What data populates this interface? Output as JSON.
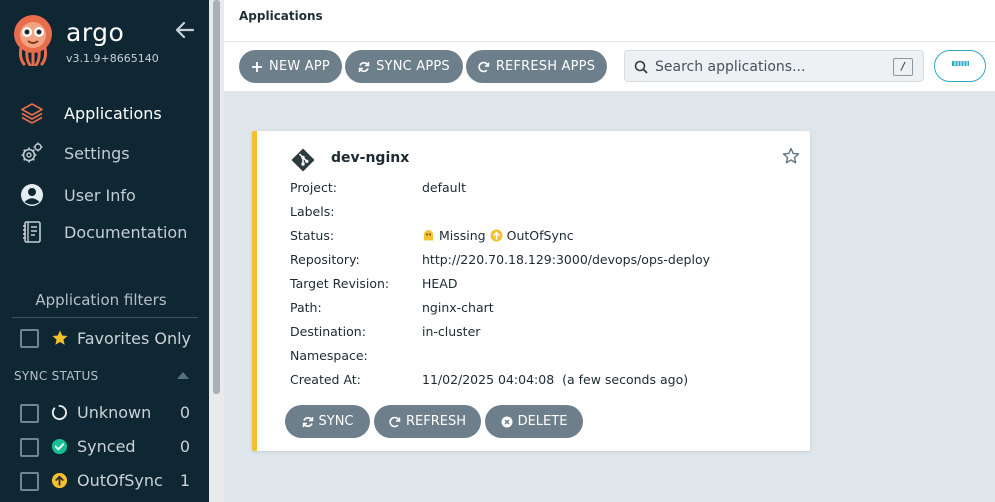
{
  "sidebar": {
    "brand": "argo",
    "version": "v3.1.9+8665140",
    "nav": [
      {
        "label": "Applications",
        "icon": "layers-icon",
        "active": true
      },
      {
        "label": "Settings",
        "icon": "gears-icon",
        "active": false
      },
      {
        "label": "User Info",
        "icon": "user-circle-icon",
        "active": false
      },
      {
        "label": "Documentation",
        "icon": "book-icon",
        "active": false
      }
    ],
    "filters_title": "Application filters",
    "favorites_label": "Favorites Only",
    "sync_status_header": "SYNC STATUS",
    "sync_filters": [
      {
        "label": "Unknown",
        "count": "0",
        "icon": "circle-notch-icon"
      },
      {
        "label": "Synced",
        "count": "0",
        "icon": "check-circle-icon"
      },
      {
        "label": "OutOfSync",
        "count": "1",
        "icon": "arrow-up-circle-icon"
      }
    ]
  },
  "header": {
    "breadcrumb": "Applications"
  },
  "toolbar": {
    "new_app": "NEW APP",
    "sync_apps": "SYNC APPS",
    "refresh_apps": "REFRESH APPS",
    "search_placeholder": "Search applications...",
    "search_shortcut": "/"
  },
  "app": {
    "name": "dev-nginx",
    "fields": [
      {
        "key": "Project:",
        "value": "default"
      },
      {
        "key": "Labels:",
        "value": ""
      },
      {
        "key": "Status:",
        "value": ""
      },
      {
        "key": "Repository:",
        "value": "http://220.70.18.129:3000/devops/ops-deploy"
      },
      {
        "key": "Target Revision:",
        "value": "HEAD"
      },
      {
        "key": "Path:",
        "value": "nginx-chart"
      },
      {
        "key": "Destination:",
        "value": "in-cluster"
      },
      {
        "key": "Namespace:",
        "value": ""
      },
      {
        "key": "Created At:",
        "value": "11/02/2025 04:04:08  (a few seconds ago)"
      }
    ],
    "health_status": "Missing",
    "sync_status": "OutOfSync",
    "actions": {
      "sync": "SYNC",
      "refresh": "REFRESH",
      "delete": "DELETE"
    }
  },
  "colors": {
    "sidebar_bg": "#0f2733",
    "button_gray": "#6d7f8b",
    "out_of_sync": "#f4c030",
    "synced": "#18be94",
    "accent_teal": "#2ea8c4",
    "active_icon": "#e96d4c"
  }
}
